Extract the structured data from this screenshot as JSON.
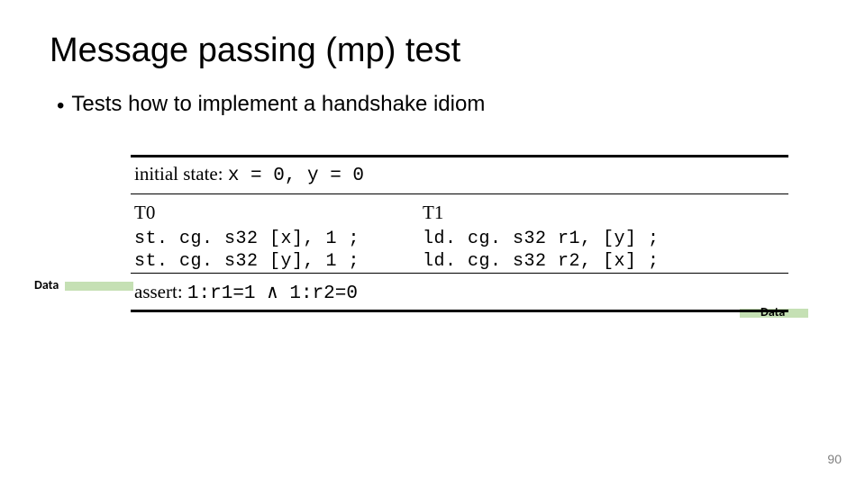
{
  "title": "Message passing (mp) test",
  "bullet": "Tests how to implement a handshake idiom",
  "initial_state_label": "initial state:",
  "initial_state_expr": "x = 0, y = 0",
  "threads": {
    "t0": "T0",
    "t1": "T1"
  },
  "code": {
    "row1_left": "st. cg. s32  [x],  1  ;",
    "row1_right": "ld. cg. s32  r1,  [y]  ;",
    "row2_left": "st. cg. s32  [y],  1  ;",
    "row2_right": "ld. cg. s32  r2,  [x]  ;"
  },
  "assert_label": "assert:",
  "assert_expr": "1:r1=1 ∧ 1:r2=0",
  "data_labels": {
    "left": "Data",
    "right": "Data"
  },
  "page_number": "90"
}
